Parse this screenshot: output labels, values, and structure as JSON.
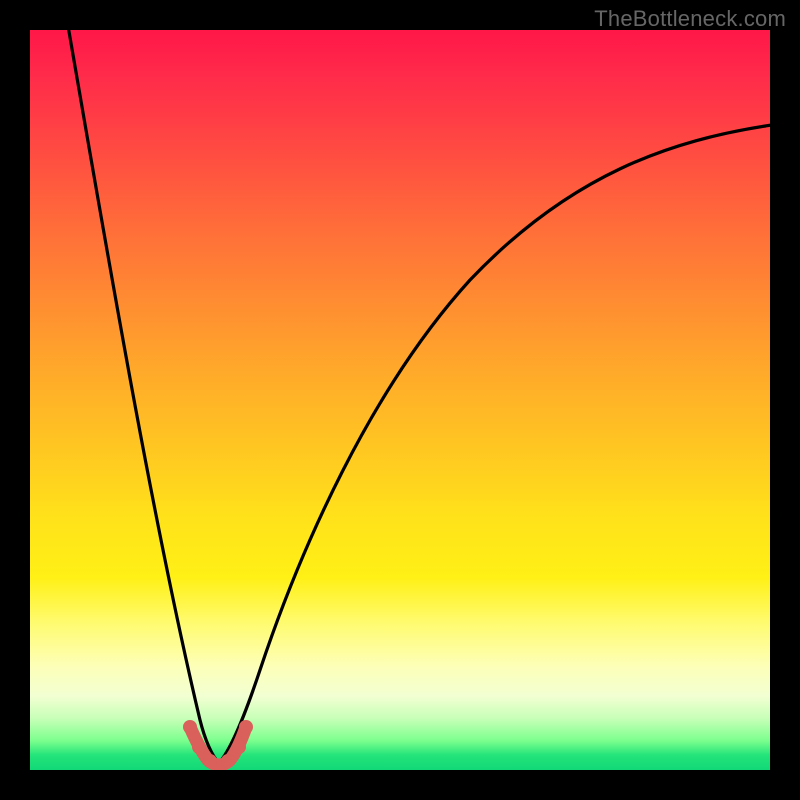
{
  "watermark": {
    "text": "TheBottleneck.com"
  },
  "chart_data": {
    "type": "line",
    "title": "",
    "xlabel": "",
    "ylabel": "",
    "xlim": [
      0,
      100
    ],
    "ylim": [
      0,
      100
    ],
    "min_x": 25,
    "series": [
      {
        "name": "left-branch",
        "x": [
          5,
          7,
          9,
          11,
          13,
          15,
          17,
          19,
          21,
          23,
          25
        ],
        "y": [
          100,
          86,
          73,
          61,
          50,
          40,
          31,
          22,
          14,
          7,
          0
        ]
      },
      {
        "name": "right-branch",
        "x": [
          25,
          28,
          32,
          37,
          43,
          50,
          58,
          67,
          77,
          88,
          100
        ],
        "y": [
          0,
          10,
          21,
          33,
          45,
          56,
          66,
          74,
          80,
          84,
          87
        ]
      }
    ],
    "marker": {
      "description": "minimum indicator",
      "color": "#d9605b",
      "points_x": [
        21.5,
        22.8,
        24.3,
        25.7,
        27.2,
        28.5
      ],
      "points_y": [
        5.0,
        2.4,
        1.1,
        1.1,
        2.4,
        5.0
      ]
    },
    "background_gradient": {
      "top": "#ff1748",
      "mid": "#ffe21a",
      "bottom": "#11d877"
    }
  }
}
